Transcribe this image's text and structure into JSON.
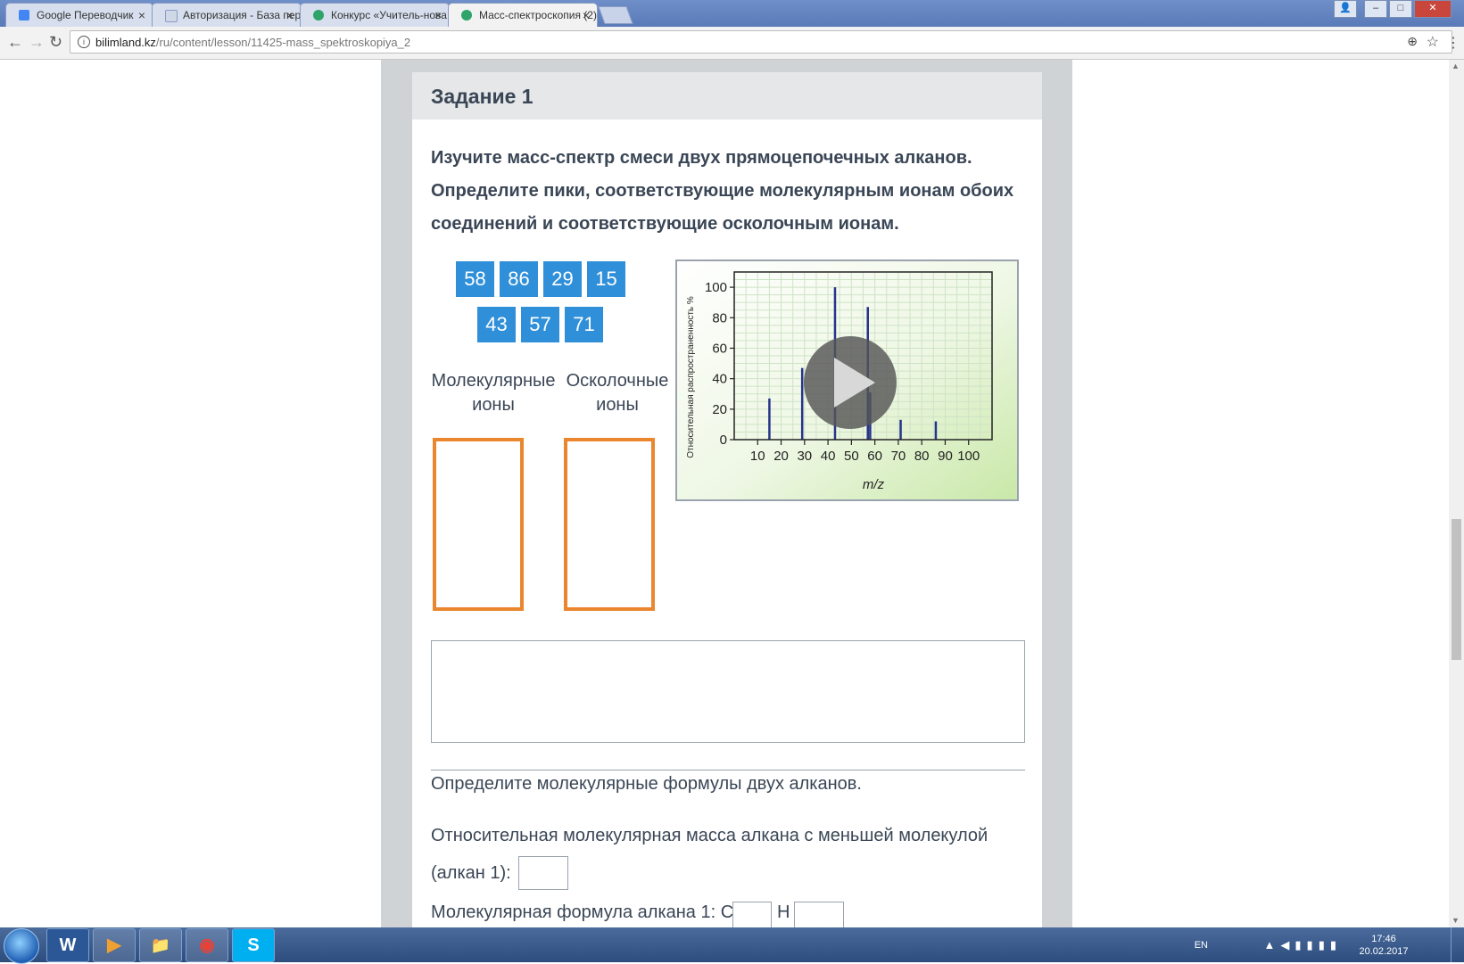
{
  "browser": {
    "tabs": [
      {
        "label": "Google Переводчик",
        "favicon_color": "#4285f4"
      },
      {
        "label": "Авторизация - База пер",
        "favicon_color": "#cfd8e6"
      },
      {
        "label": "Конкурс «Учитель-нова",
        "favicon_color": "#2ea36a"
      },
      {
        "label": "Масс-спектроскопия (2)",
        "favicon_color": "#2ea36a"
      }
    ],
    "tab_close_glyph": "×",
    "url_domain": "bilimland.kz",
    "url_path": "/ru/content/lesson/11425-mass_spektroskopiya_2",
    "window_buttons": [
      "–",
      "□",
      "✕"
    ]
  },
  "card": {
    "title": "Задание 1",
    "task_lines": [
      "Изучите масс-спектр смеси двух прямоцепочечных алканов.",
      "Определите пики, соответствующие молекулярным ионам обоих",
      "соединений и соответствующие осколочным ионам."
    ],
    "chips_row1": [
      "58",
      "86",
      "29",
      "15"
    ],
    "chips_row2": [
      "43",
      "57",
      "71"
    ],
    "label_molecular": [
      "Молекулярные",
      "ионы"
    ],
    "label_fragment": [
      "Осколочные",
      "ионы"
    ],
    "q1": "Определите молекулярные формулы двух алканов.",
    "q2_line1": "Относительная молекулярная масса алкана с меньшей молекулой",
    "q2_line2": "(алкан 1):",
    "q3_prefix": "Молекулярная формула алкана 1: C",
    "q3_h": "H"
  },
  "chart_data": {
    "type": "bar",
    "title": "",
    "xlabel": "m/z",
    "ylabel": "Относительная распространенность %",
    "x_ticks": [
      "10",
      "20",
      "30",
      "40",
      "50",
      "60",
      "70",
      "80",
      "90",
      "100"
    ],
    "y_ticks": [
      "0",
      "20",
      "40",
      "60",
      "80",
      "100"
    ],
    "xlim": [
      0,
      110
    ],
    "ylim": [
      0,
      110
    ],
    "x": [
      15,
      29,
      43,
      57,
      58,
      71,
      86
    ],
    "values": [
      27,
      47,
      100,
      87,
      31,
      13,
      12
    ],
    "bar_color": "#26348a",
    "overlay": "play-button"
  },
  "taskbar": {
    "apps": [
      "W",
      "▶",
      "📁",
      "◉",
      "S"
    ],
    "lang": "EN",
    "tray_icons": "▲◀▮▮▮▮",
    "time": "17:46",
    "date": "20.02.2017"
  }
}
